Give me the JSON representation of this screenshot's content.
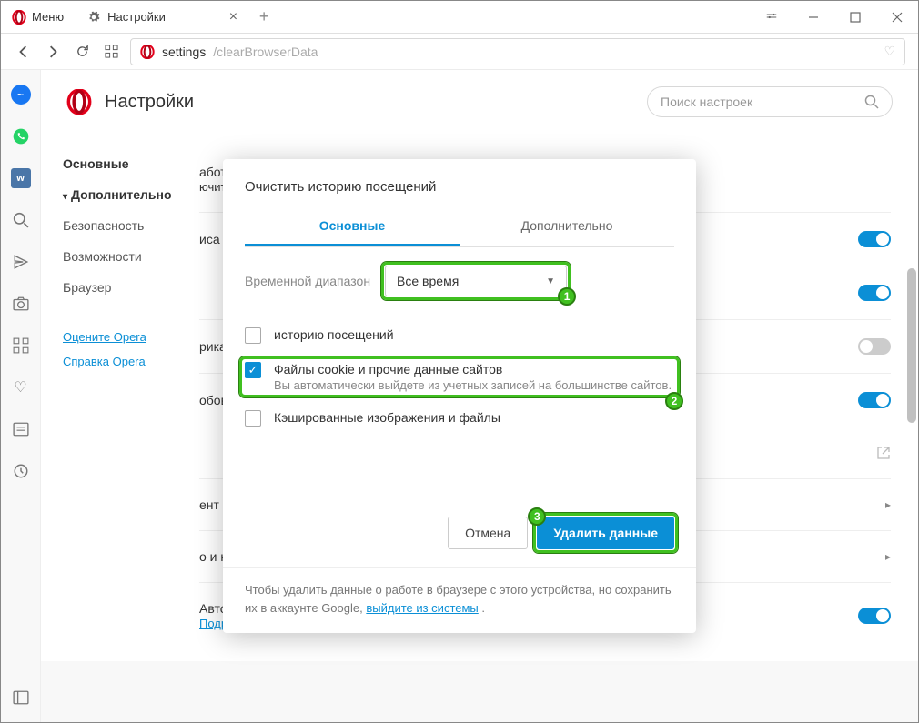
{
  "titlebar": {
    "menu_label": "Меню",
    "tab_label": "Настройки"
  },
  "url": {
    "prefix": "settings",
    "suffix": "/clearBrowserData"
  },
  "header": {
    "title": "Настройки",
    "search_placeholder": "Поиск настроек"
  },
  "sidenav": {
    "items": [
      "Основные",
      "Дополнительно",
      "Безопасность",
      "Возможности",
      "Браузер"
    ],
    "links": [
      "Оцените Opera",
      "Справка Opera"
    ]
  },
  "bg_rows": {
    "r1a": "аботу в сети еще",
    "r1b": "ючить",
    "r2": "иса подсказок в",
    "r4": "рика",
    "r5": "обов оплаты",
    "r7": "ент показывать на",
    "r8": "о и кеш",
    "r9": "Автоматически отправлять отчеты об аварийном завершении в Opera",
    "more": "Подробнее..."
  },
  "dialog": {
    "title": "Очистить историю посещений",
    "tab_basic": "Основные",
    "tab_adv": "Дополнительно",
    "range_label": "Временной диапазон",
    "range_value": "Все время",
    "opt1": "историю посещений",
    "opt2_title": "Файлы cookie и прочие данные сайтов",
    "opt2_sub": "Вы автоматически выйдете из учетных записей на большинстве сайтов.",
    "opt3": "Кэшированные изображения и файлы",
    "cancel": "Отмена",
    "confirm": "Удалить данные",
    "footer_text": "Чтобы удалить данные о работе в браузере с этого устройства, но сохранить их в аккаунте Google,  ",
    "footer_link": "выйдите из системы"
  },
  "badges": {
    "b1": "1",
    "b2": "2",
    "b3": "3"
  }
}
